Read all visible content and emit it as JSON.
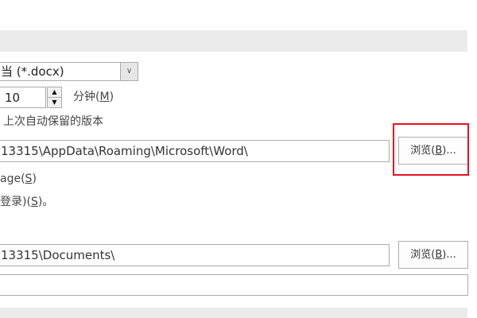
{
  "format_select": {
    "value": "当 (*.docx)"
  },
  "autosave": {
    "minutes": "10",
    "unit_label": "分钟(",
    "unit_key": "M",
    ")": ")"
  },
  "keep_version_label": "上次自动保留的版本",
  "autorecover_path": "13315\\AppData\\Roaming\\Microsoft\\Word\\",
  "browse_label": "浏览(",
  "browse_key": "B",
  "browse_suffix": ")...",
  "option1": {
    "text": "age(",
    "key": "S",
    "suffix": ")"
  },
  "option2": {
    "text": "登录)(",
    "key": "S",
    "suffix": ")。"
  },
  "default_local_path": "13315\\Documents\\",
  "extra_path": "",
  "highlight_color": "#e81123"
}
